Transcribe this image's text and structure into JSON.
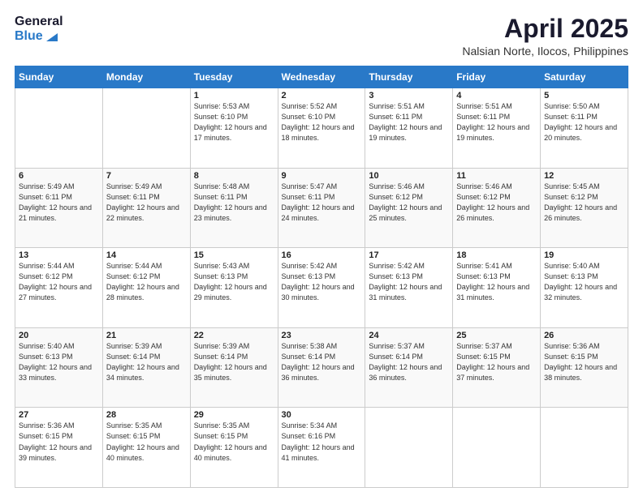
{
  "logo": {
    "general": "General",
    "blue": "Blue"
  },
  "header": {
    "month": "April 2025",
    "location": "Nalsian Norte, Ilocos, Philippines"
  },
  "days_of_week": [
    "Sunday",
    "Monday",
    "Tuesday",
    "Wednesday",
    "Thursday",
    "Friday",
    "Saturday"
  ],
  "weeks": [
    [
      {
        "day": "",
        "info": ""
      },
      {
        "day": "",
        "info": ""
      },
      {
        "day": "1",
        "info": "Sunrise: 5:53 AM\nSunset: 6:10 PM\nDaylight: 12 hours and 17 minutes."
      },
      {
        "day": "2",
        "info": "Sunrise: 5:52 AM\nSunset: 6:10 PM\nDaylight: 12 hours and 18 minutes."
      },
      {
        "day": "3",
        "info": "Sunrise: 5:51 AM\nSunset: 6:11 PM\nDaylight: 12 hours and 19 minutes."
      },
      {
        "day": "4",
        "info": "Sunrise: 5:51 AM\nSunset: 6:11 PM\nDaylight: 12 hours and 19 minutes."
      },
      {
        "day": "5",
        "info": "Sunrise: 5:50 AM\nSunset: 6:11 PM\nDaylight: 12 hours and 20 minutes."
      }
    ],
    [
      {
        "day": "6",
        "info": "Sunrise: 5:49 AM\nSunset: 6:11 PM\nDaylight: 12 hours and 21 minutes."
      },
      {
        "day": "7",
        "info": "Sunrise: 5:49 AM\nSunset: 6:11 PM\nDaylight: 12 hours and 22 minutes."
      },
      {
        "day": "8",
        "info": "Sunrise: 5:48 AM\nSunset: 6:11 PM\nDaylight: 12 hours and 23 minutes."
      },
      {
        "day": "9",
        "info": "Sunrise: 5:47 AM\nSunset: 6:11 PM\nDaylight: 12 hours and 24 minutes."
      },
      {
        "day": "10",
        "info": "Sunrise: 5:46 AM\nSunset: 6:12 PM\nDaylight: 12 hours and 25 minutes."
      },
      {
        "day": "11",
        "info": "Sunrise: 5:46 AM\nSunset: 6:12 PM\nDaylight: 12 hours and 26 minutes."
      },
      {
        "day": "12",
        "info": "Sunrise: 5:45 AM\nSunset: 6:12 PM\nDaylight: 12 hours and 26 minutes."
      }
    ],
    [
      {
        "day": "13",
        "info": "Sunrise: 5:44 AM\nSunset: 6:12 PM\nDaylight: 12 hours and 27 minutes."
      },
      {
        "day": "14",
        "info": "Sunrise: 5:44 AM\nSunset: 6:12 PM\nDaylight: 12 hours and 28 minutes."
      },
      {
        "day": "15",
        "info": "Sunrise: 5:43 AM\nSunset: 6:13 PM\nDaylight: 12 hours and 29 minutes."
      },
      {
        "day": "16",
        "info": "Sunrise: 5:42 AM\nSunset: 6:13 PM\nDaylight: 12 hours and 30 minutes."
      },
      {
        "day": "17",
        "info": "Sunrise: 5:42 AM\nSunset: 6:13 PM\nDaylight: 12 hours and 31 minutes."
      },
      {
        "day": "18",
        "info": "Sunrise: 5:41 AM\nSunset: 6:13 PM\nDaylight: 12 hours and 31 minutes."
      },
      {
        "day": "19",
        "info": "Sunrise: 5:40 AM\nSunset: 6:13 PM\nDaylight: 12 hours and 32 minutes."
      }
    ],
    [
      {
        "day": "20",
        "info": "Sunrise: 5:40 AM\nSunset: 6:13 PM\nDaylight: 12 hours and 33 minutes."
      },
      {
        "day": "21",
        "info": "Sunrise: 5:39 AM\nSunset: 6:14 PM\nDaylight: 12 hours and 34 minutes."
      },
      {
        "day": "22",
        "info": "Sunrise: 5:39 AM\nSunset: 6:14 PM\nDaylight: 12 hours and 35 minutes."
      },
      {
        "day": "23",
        "info": "Sunrise: 5:38 AM\nSunset: 6:14 PM\nDaylight: 12 hours and 36 minutes."
      },
      {
        "day": "24",
        "info": "Sunrise: 5:37 AM\nSunset: 6:14 PM\nDaylight: 12 hours and 36 minutes."
      },
      {
        "day": "25",
        "info": "Sunrise: 5:37 AM\nSunset: 6:15 PM\nDaylight: 12 hours and 37 minutes."
      },
      {
        "day": "26",
        "info": "Sunrise: 5:36 AM\nSunset: 6:15 PM\nDaylight: 12 hours and 38 minutes."
      }
    ],
    [
      {
        "day": "27",
        "info": "Sunrise: 5:36 AM\nSunset: 6:15 PM\nDaylight: 12 hours and 39 minutes."
      },
      {
        "day": "28",
        "info": "Sunrise: 5:35 AM\nSunset: 6:15 PM\nDaylight: 12 hours and 40 minutes."
      },
      {
        "day": "29",
        "info": "Sunrise: 5:35 AM\nSunset: 6:15 PM\nDaylight: 12 hours and 40 minutes."
      },
      {
        "day": "30",
        "info": "Sunrise: 5:34 AM\nSunset: 6:16 PM\nDaylight: 12 hours and 41 minutes."
      },
      {
        "day": "",
        "info": ""
      },
      {
        "day": "",
        "info": ""
      },
      {
        "day": "",
        "info": ""
      }
    ]
  ]
}
